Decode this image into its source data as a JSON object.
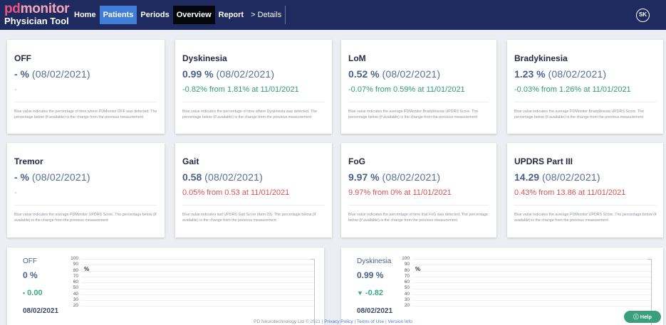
{
  "header": {
    "brand_part1": "pd",
    "brand_part2": "m",
    "brand_part3": "nitor",
    "brand_dot": "o",
    "subtitle": "Physician Tool",
    "nav": {
      "home": "Home",
      "patients": "Patients",
      "periods": "Periods",
      "overview": "Overview",
      "report": "Report",
      "details": "> Details"
    },
    "avatar_initials": "SK"
  },
  "cards": [
    {
      "title": "OFF",
      "value": "- %",
      "date": "(08/02/2021)",
      "change": "-",
      "change_color": "grey",
      "note": "Blue value indicates the percentage of time where PDMonitor OFF was detected. The percentage below (if available) is the change from the previous measurement"
    },
    {
      "title": "Dyskinesia",
      "value": "0.99 %",
      "date": "(08/02/2021)",
      "change": "-0.82% from 1.81% at 11/01/2021",
      "change_color": "green",
      "note": "Blue value indicates the percentage of time where Dyskinesia was detected. The percentage below (if available) is the change from the previous measurement"
    },
    {
      "title": "LoM",
      "value": "0.52 %",
      "date": "(08/02/2021)",
      "change": "-0.07% from 0.59% at 11/01/2021",
      "change_color": "green",
      "note": "Blue value indicates the average PDMonitor Bradykinesia UPDRS Score. The percentage below (if available) is the change from the previous measurement"
    },
    {
      "title": "Bradykinesia",
      "value": "1.23 %",
      "date": "(08/02/2021)",
      "change": "-0.03% from 1.26% at 11/01/2021",
      "change_color": "green",
      "note": "Blue value indicates the average PDMonitor Bradykinesia UPDRS Score. The percentage below (if available) is the change from the previous measurement"
    },
    {
      "title": "Tremor",
      "value": "- %",
      "date": "(08/02/2021)",
      "change": "-",
      "change_color": "grey",
      "note": "Blue value indicates the average PDMonitor UPDRS Score. The percentage below (if available) is the change from the previous measurement"
    },
    {
      "title": "Gait",
      "value": "0.58",
      "date": "(08/02/2021)",
      "change": "0.05% from 0.53 at 11/01/2021",
      "change_color": "red",
      "note": "Blue value indicates last UPDRS Gait Score (Item 29). The percentage below (if available) is the change from the previous measurement"
    },
    {
      "title": "FoG",
      "value": "9.97 %",
      "date": "(08/02/2021)",
      "change": "9.97% from 0% at 11/01/2021",
      "change_color": "red",
      "note": "Blue value indicates the percentage of time that FoG was detected. The percentage below (if available) is the change from the previous measurement"
    },
    {
      "title": "UPDRS Part III",
      "value": "14.29",
      "date": "(08/02/2021)",
      "change": "0.43% from 13.86 at 11/01/2021",
      "change_color": "red",
      "note": "Blue value indicates the average PDMonitor UPDRS Score. The percentage below (if available) is the change from the previous measurement"
    }
  ],
  "panels": [
    {
      "title": "OFF",
      "value": "0 %",
      "change": "0.00",
      "change_arrow": "•",
      "date": "08/02/2021",
      "unit": "%",
      "ticks": [
        "100",
        "90",
        "80",
        "70",
        "60",
        "50",
        "40",
        "30",
        "20"
      ]
    },
    {
      "title": "Dyskinesia",
      "value": "0.99 %",
      "change": "-0.82",
      "change_arrow": "▼",
      "date": "08/02/2021",
      "unit": "%",
      "ticks": [
        "100",
        "90",
        "80",
        "70",
        "60",
        "50",
        "40",
        "30",
        "20"
      ]
    }
  ],
  "footer": {
    "copyright": "PD Neurotechnology Ltd © 2021",
    "privacy": "Privacy Policy",
    "terms": "Terms of Use",
    "version": "Version Info",
    "separator": "|"
  },
  "help_label": "ⓘ Help",
  "colors": {
    "nav_bg": "#1f2b5e",
    "nav_active": "#3f7dd6",
    "value_blue": "#4a5f88",
    "change_green": "#2e9d72",
    "change_red": "#d9534f",
    "help_green": "#3aa07c"
  }
}
